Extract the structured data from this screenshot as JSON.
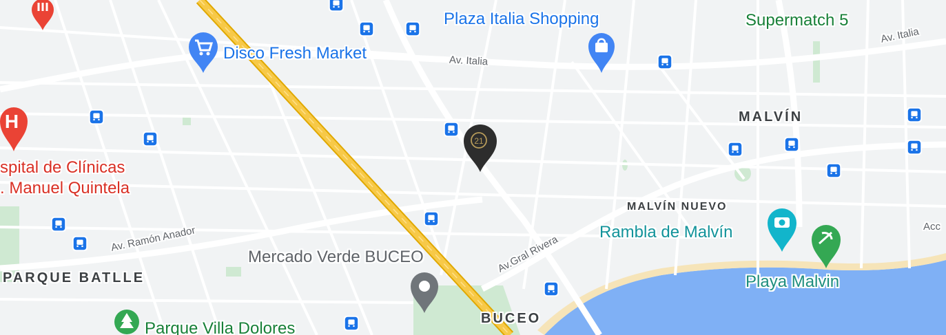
{
  "map": {
    "colors": {
      "land": "#f1f3f4",
      "road": "#ffffff",
      "highway": "#f7c948",
      "water": "#7fb0f5",
      "park": "#cfe9d2",
      "beach": "#f6e4b8",
      "transit": "#1a73e8"
    },
    "labels": {
      "plaza_italia": "Plaza Italia Shopping",
      "supermatch": "Supermatch 5",
      "disco": "Disco Fresh Market",
      "av_italia_1": "Av. Italia",
      "av_italia_2": "Av. Italia",
      "malvin": "MALVÍN",
      "hospital_line1": "spital de Clínicas",
      "hospital_line2": ". Manuel Quintela",
      "malvin_nuevo": "MALVÍN NUEVO",
      "rambla": "Rambla de Malvín",
      "acc_partial": "Acc",
      "ramon_anador": "Av. Ramón Anador",
      "gral_rivera": "Av.Gral Rivera",
      "mercado": "Mercado Verde BUCEO",
      "parque_batlle": "PARQUE BATLLE",
      "playa": "Playa Malvin",
      "buceo": "BUCEO",
      "villa_dolores": "Parque Villa Dolores"
    },
    "main_marker": {
      "icon": "century21-marker-icon",
      "text": "21"
    },
    "hospital_glyph": "H"
  }
}
